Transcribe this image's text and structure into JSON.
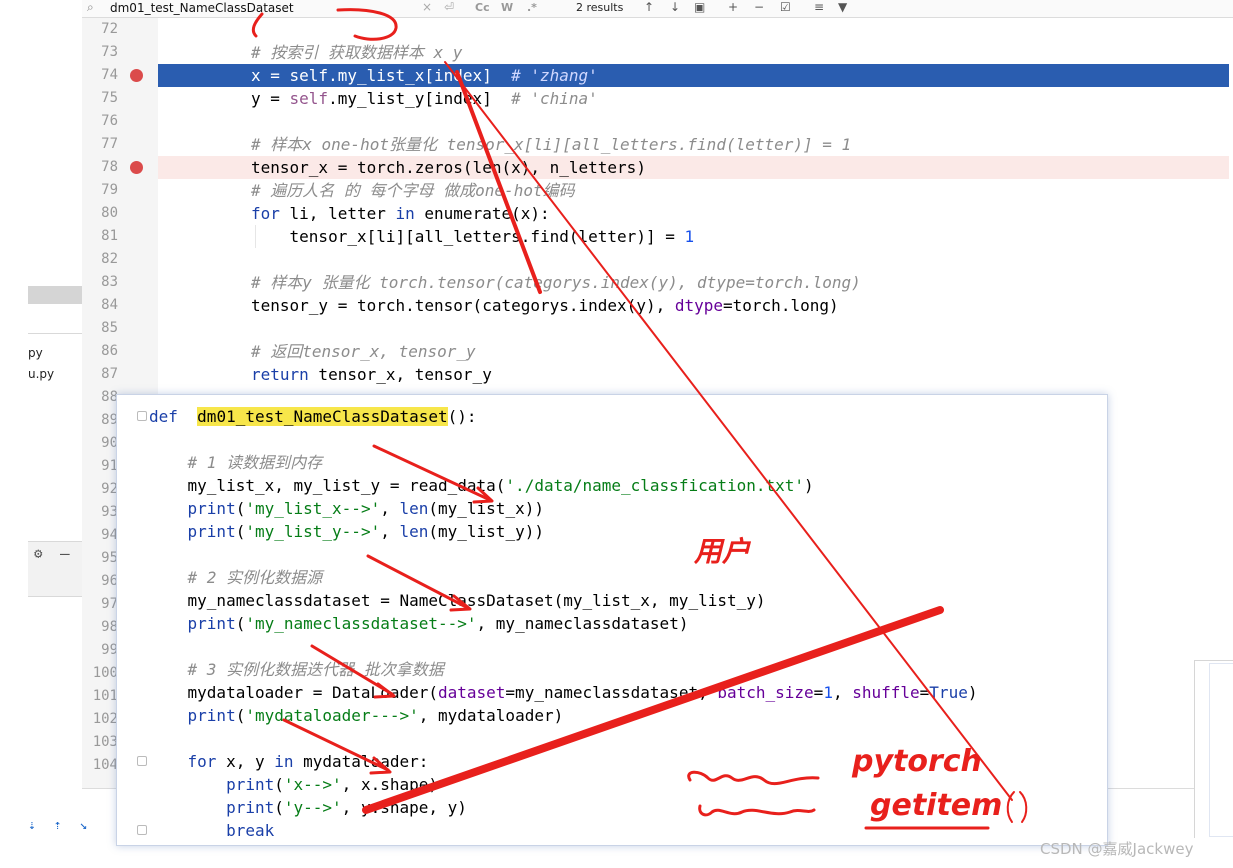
{
  "search": {
    "query": "dm01_test_NameClassDataset",
    "results": "2 results",
    "opt_case": "Cc",
    "opt_word": "W",
    "opt_regex": ".*"
  },
  "sidebar": {
    "files": [
      "py",
      "u.py"
    ]
  },
  "editor": {
    "lines": [
      {
        "n": "72",
        "html": ""
      },
      {
        "n": "73",
        "html": "<span class='cm'># 按索引 获取数据样本 x y</span>"
      },
      {
        "n": "74",
        "html": "x = self.my_list_x[index]  <span class='cm'># 'zhang'</span>",
        "hl": true,
        "bp": true
      },
      {
        "n": "75",
        "html": "y = <span class='slf'>self</span>.my_list_y[index]  <span class='cm'># 'china'</span>"
      },
      {
        "n": "76",
        "html": ""
      },
      {
        "n": "77",
        "html": "<span class='cm'># 样本x one-hot张量化 tensor_x[li][all_letters.find(letter)] = 1</span>"
      },
      {
        "n": "78",
        "html": "tensor_x = torch.zeros(len(x), n_letters)",
        "bp": true,
        "bprow": true
      },
      {
        "n": "79",
        "html": "<span class='cm'># 遍历人名 的 每个字母 做成one-hot编码</span>"
      },
      {
        "n": "80",
        "html": "<span class='kw'>for</span> li, letter <span class='kw'>in</span> enumerate(x):"
      },
      {
        "n": "81",
        "html": "    tensor_x[li][all_letters.find(letter)] = <span class='num'>1</span>"
      },
      {
        "n": "82",
        "html": ""
      },
      {
        "n": "83",
        "html": "<span class='cm'># 样本y 张量化 torch.tensor(categorys.index(y), dtype=torch.long)</span>"
      },
      {
        "n": "84",
        "html": "tensor_y = torch.tensor(categorys.index(y), <span class='prm'>dtype</span>=torch.long)"
      },
      {
        "n": "85",
        "html": ""
      },
      {
        "n": "86",
        "html": "<span class='cm'># 返回tensor_x, tensor_y</span>"
      },
      {
        "n": "87",
        "html": "<span class='kw'>return</span> tensor_x, tensor_y"
      },
      {
        "n": "88",
        "html": ""
      },
      {
        "n": "89",
        "html": ""
      },
      {
        "n": "90",
        "html": ""
      },
      {
        "n": "91",
        "html": ""
      },
      {
        "n": "92",
        "html": ""
      },
      {
        "n": "93",
        "html": ""
      },
      {
        "n": "94",
        "html": ""
      },
      {
        "n": "95",
        "html": ""
      },
      {
        "n": "96",
        "html": ""
      },
      {
        "n": "97",
        "html": ""
      },
      {
        "n": "98",
        "html": ""
      },
      {
        "n": "99",
        "html": ""
      },
      {
        "n": "100",
        "html": ""
      },
      {
        "n": "101",
        "html": ""
      },
      {
        "n": "102",
        "html": ""
      },
      {
        "n": "103",
        "html": ""
      },
      {
        "n": "104",
        "html": ""
      }
    ]
  },
  "popup": {
    "lines": [
      "<span class='kw'>def</span>  <span class='fname-hl'>dm01_test_NameClassDataset</span>():",
      "",
      "    <span class='cm'># 1 读数据到内存</span>",
      "    my_list_x, my_list_y = read_data(<span class='str'>'./data/name_classfication.txt'</span>)",
      "    <span class='kw'>print</span>(<span class='str'>'my_list_x--&gt;'</span>, <span class='kw'>len</span>(my_list_x))",
      "    <span class='kw'>print</span>(<span class='str'>'my_list_y--&gt;'</span>, <span class='kw'>len</span>(my_list_y))",
      "",
      "    <span class='cm'># 2 实例化数据源</span>",
      "    my_nameclassdataset = NameClassDataset(my_list_x, my_list_y)",
      "    <span class='kw'>print</span>(<span class='str'>'my_nameclassdataset--&gt;'</span>, my_nameclassdataset)",
      "",
      "    <span class='cm'># 3 实例化数据迭代器 批次拿数据</span>",
      "    mydataloader = DataLoader(<span class='prm'>dataset</span>=my_nameclassdataset, <span class='prm'>batch_size</span>=<span class='num'>1</span>, <span class='prm'>shuffle</span>=<span class='kw'>True</span>)",
      "    <span class='kw'>print</span>(<span class='str'>'mydataloader---&gt;'</span>, mydataloader)",
      "",
      "    <span class='kw'>for</span> x, y <span class='kw'>in</span> mydataloader:",
      "        <span class='kw'>print</span>(<span class='str'>'x--&gt;'</span>, x.shape)",
      "        <span class='kw'>print</span>(<span class='str'>'y--&gt;'</span>, y.shape, y)",
      "        <span class='kw'>break</span>"
    ]
  },
  "annotations": {
    "user": "用户",
    "pytorch": "pytorch",
    "getitem": "getitem",
    "parens": "()"
  },
  "watermark": "CSDN @嘉威Jackwey",
  "colors": {
    "highlight": "#2a5db0",
    "breakpoint": "#db4b4b",
    "annotation": "#e8201c"
  }
}
